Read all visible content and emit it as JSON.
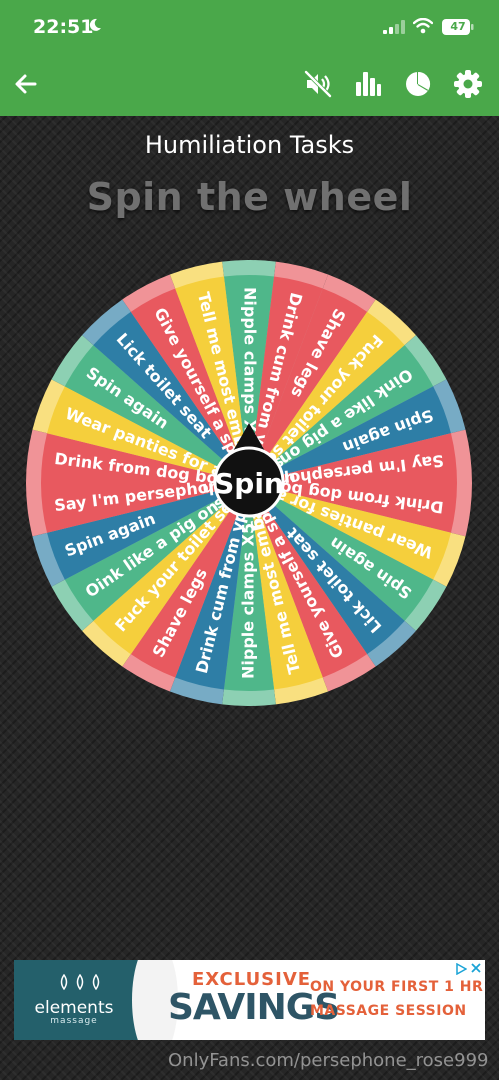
{
  "status_bar": {
    "time": "22:51",
    "battery": "47"
  },
  "app_bar": {
    "icons": [
      "back-arrow-icon",
      "sound-off-icon",
      "bar-chart-icon",
      "pie-chart-icon",
      "gear-icon"
    ]
  },
  "title": "Humiliation Tasks",
  "heading": "Spin the wheel",
  "wheel": {
    "spin_label": "Spin",
    "segments": [
      {
        "label": "Nipple clamps X5",
        "color": "#4fb78a"
      },
      {
        "label": "Drink cum from your hand",
        "color": "#e8595f"
      },
      {
        "label": "Shave legs",
        "color": "#e8595f"
      },
      {
        "label": "Fuck your toilet seat",
        "color": "#f5cf3c"
      },
      {
        "label": "Oink like a pig on all fours",
        "color": "#4fb78a"
      },
      {
        "label": "Spin again",
        "color": "#2e7ea6"
      },
      {
        "label": "Say I'm persephone's bitch",
        "color": "#e8595f"
      },
      {
        "label": "Drink from dog bowl",
        "color": "#e8595f"
      },
      {
        "label": "Wear panties for a day",
        "color": "#f5cf3c"
      },
      {
        "label": "Spin again",
        "color": "#4fb78a"
      },
      {
        "label": "Lick toilet seat",
        "color": "#2e7ea6"
      },
      {
        "label": "Give yourself a spank",
        "color": "#e8595f"
      },
      {
        "label": "Tell me most embarrassing",
        "color": "#f5cf3c"
      },
      {
        "label": "Nipple clamps X5",
        "color": "#4fb78a"
      },
      {
        "label": "Drink cum from your hand",
        "color": "#2e7ea6"
      },
      {
        "label": "Shave legs",
        "color": "#e8595f"
      },
      {
        "label": "Fuck your toilet seat",
        "color": "#f5cf3c"
      },
      {
        "label": "Oink like a pig on all fours",
        "color": "#4fb78a"
      },
      {
        "label": "Spin again",
        "color": "#2e7ea6"
      },
      {
        "label": "Say I'm persephone's bitch",
        "color": "#e8595f"
      },
      {
        "label": "Drink from dog bowl",
        "color": "#e8595f"
      },
      {
        "label": "Wear panties for a day",
        "color": "#f5cf3c"
      },
      {
        "label": "Spin again",
        "color": "#4fb78a"
      },
      {
        "label": "Lick toilet seat",
        "color": "#2e7ea6"
      },
      {
        "label": "Give yourself a spank",
        "color": "#e8595f"
      },
      {
        "label": "Tell me most embarrassing",
        "color": "#f5cf3c"
      }
    ]
  },
  "ad": {
    "brand": "elements",
    "brand_sub": "massage",
    "line1": "EXCLUSIVE",
    "line2": "SAVINGS",
    "offer_line1": "ON YOUR FIRST 1 HR",
    "offer_line2": "MASSAGE SESSION"
  },
  "watermark": "OnlyFans.com/persephone_rose999"
}
